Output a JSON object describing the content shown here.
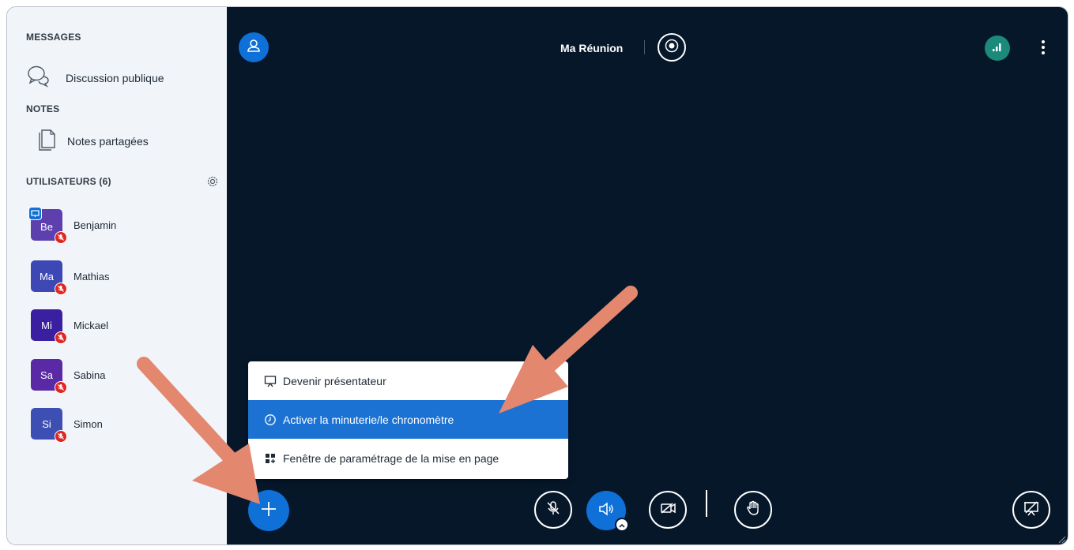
{
  "sidebar": {
    "messages_title": "MESSAGES",
    "public_chat": "Discussion publique",
    "notes_title": "NOTES",
    "shared_notes": "Notes partagées",
    "users_title": "UTILISATEURS (6)",
    "users": [
      {
        "initials": "Be",
        "name": "Benjamin",
        "color": "#5d3fae",
        "presenter": true
      },
      {
        "initials": "Ma",
        "name": "Mathias",
        "color": "#3d48b5"
      },
      {
        "initials": "Mi",
        "name": "Mickael",
        "color": "#3a1fa0"
      },
      {
        "initials": "Sa",
        "name": "Sabina",
        "color": "#5a2aa6"
      },
      {
        "initials": "Si",
        "name": "Simon",
        "color": "#3e4fb3"
      }
    ]
  },
  "header": {
    "meeting_title": "Ma Réunion"
  },
  "actions_menu": {
    "items": [
      {
        "label": "Devenir présentateur",
        "icon": "presentation-icon"
      },
      {
        "label": "Activer la minuterie/le chronomètre",
        "icon": "clock-icon",
        "active": true
      },
      {
        "label": "Fenêtre de paramétrage de la mise en page",
        "icon": "layout-icon"
      }
    ]
  },
  "colors": {
    "primary": "#0f70d7",
    "main_bg": "#06172a",
    "sidebar_bg": "#f1f4f8",
    "muted_red": "#df2721",
    "connection_green": "#1b8a7a",
    "annotation_arrow": "#e3876f"
  }
}
